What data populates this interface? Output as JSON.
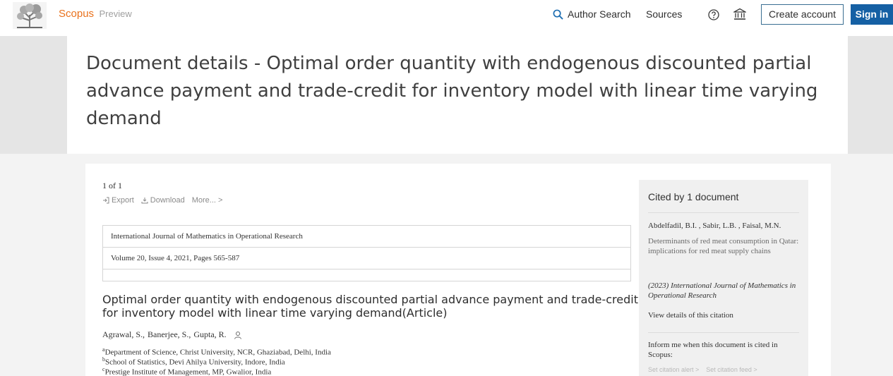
{
  "header": {
    "brand_name": "Scopus",
    "brand_suffix": "Preview",
    "author_search": "Author Search",
    "sources": "Sources",
    "create_account": "Create account",
    "sign_in": "Sign in"
  },
  "page_title": "Document details - Optimal order quantity with endogenous discounted partial advance payment and trade-credit for inventory model with linear time varying demand",
  "document": {
    "pager": "1 of 1",
    "actions": {
      "export": "Export",
      "download": "Download",
      "more": "More... >"
    },
    "journal": "International Journal of Mathematics in Operational Research",
    "volume_info": "Volume 20, Issue 4, 2021, Pages 565-587",
    "article_title": "Optimal order quantity with endogenous discounted partial advance payment and trade-credit for inventory model with linear time varying demand(Article)",
    "authors": [
      "Agrawal, S.,",
      "Banerjee, S.,",
      "Gupta, R."
    ],
    "affiliations": [
      {
        "mark": "a",
        "text": "Department of Science, Christ University, NCR, Ghaziabad, Delhi, India"
      },
      {
        "mark": "b",
        "text": "School of Statistics, Devi Ahilya University, Indore, India"
      },
      {
        "mark": "c",
        "text": "Prestige Institute of Management, MP, Gwalior, India"
      }
    ]
  },
  "sidebar": {
    "cited_by": "Cited by 1 document",
    "citation": {
      "authors": "Abdelfadil, B.I. , Sabir, L.B. , Faisal, M.N.",
      "title": "Determinants of red meat consumption in Qatar: implications for red meat supply chains",
      "source": "(2023) International Journal of Mathematics in Operational Research",
      "view_details": "View details of this citation"
    },
    "inform_text": "Inform me when this document is cited in Scopus:",
    "set_alert": "Set citation alert >",
    "set_feed": "Set citation feed >"
  },
  "colors": {
    "brand_orange": "#e9711c",
    "primary_blue": "#1560a4",
    "link_blue": "#1f6fb2"
  },
  "icons": [
    "scopus-tree-logo",
    "search-icon",
    "help-icon",
    "institution-icon",
    "export-icon",
    "download-icon",
    "person-icon"
  ]
}
